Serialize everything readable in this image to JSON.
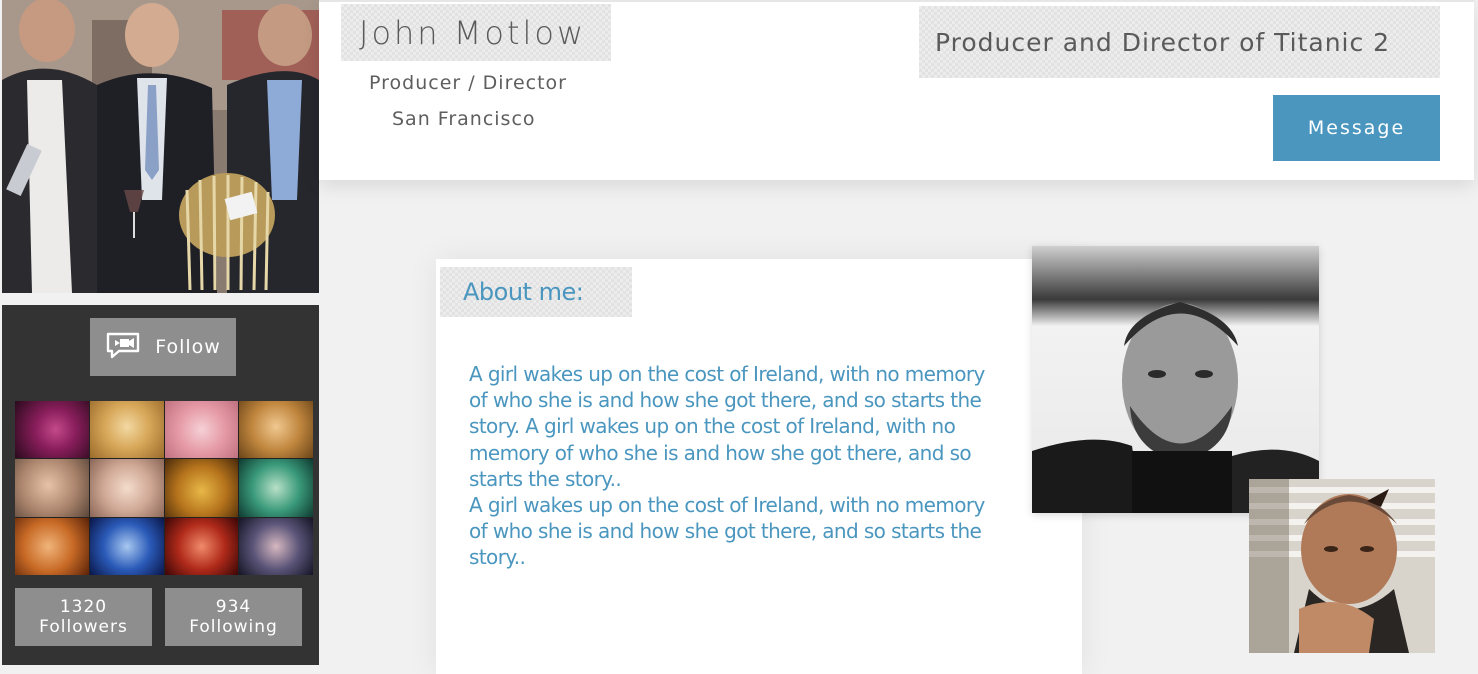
{
  "profile": {
    "name": "John Motlow",
    "role": "Producer /  Director",
    "location": "San Francisco",
    "tagline": "Producer and Director of Titanic 2",
    "message_label": "Message"
  },
  "sidebar": {
    "follow_label": "Follow",
    "followers": {
      "count": "1320",
      "label": "Followers"
    },
    "following": {
      "count": "934",
      "label": "Following"
    }
  },
  "about": {
    "title": "About me:",
    "paragraph_1": "A girl wakes up on the cost of Ireland, with no memory of who she is and how she got there, and so starts the story. A girl wakes up on the cost of Ireland, with no memory of who she is and how she got there, and so starts the story..",
    "paragraph_2": "A girl wakes up on the cost of Ireland, with no memory of who she is and how she got there, and so starts the story.."
  },
  "colors": {
    "accent": "#4a96bf",
    "sidebar_bg": "#333333",
    "button_gray": "#8e8e8e"
  },
  "icons": {
    "follow": "chat-bubble-film-icon"
  }
}
